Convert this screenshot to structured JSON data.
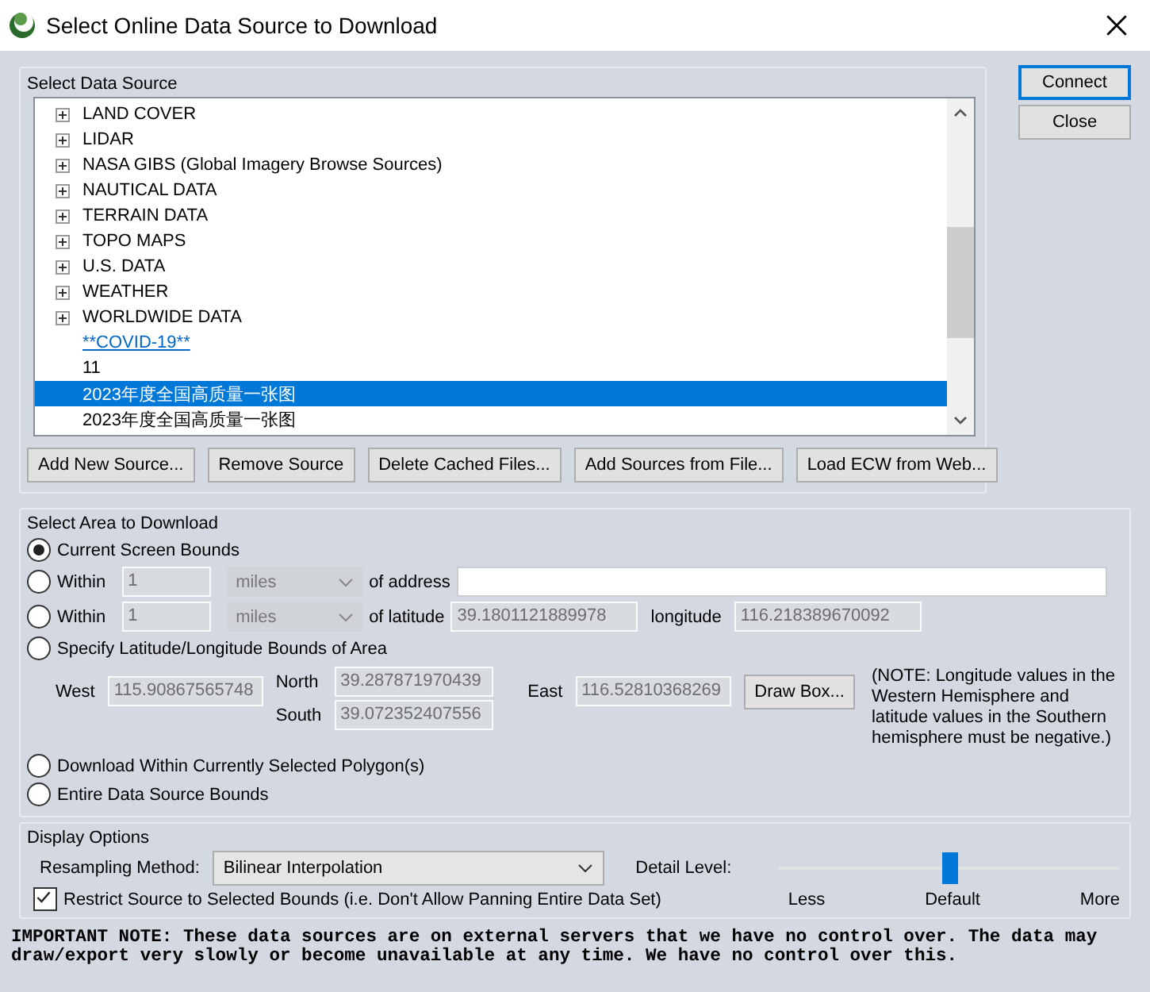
{
  "window": {
    "title": "Select Online Data Source to Download"
  },
  "side_buttons": [
    {
      "label": "Connect",
      "default": true
    },
    {
      "label": "Close",
      "default": false
    }
  ],
  "source_group": {
    "title": "Select Data Source",
    "items": [
      {
        "label": "LAND COVER",
        "kind": "folder",
        "selected": false
      },
      {
        "label": "LIDAR",
        "kind": "folder",
        "selected": false
      },
      {
        "label": "NASA GIBS (Global Imagery Browse Sources)",
        "kind": "folder",
        "selected": false
      },
      {
        "label": "NAUTICAL DATA",
        "kind": "folder",
        "selected": false
      },
      {
        "label": "TERRAIN DATA",
        "kind": "folder",
        "selected": false
      },
      {
        "label": "TOPO MAPS",
        "kind": "folder",
        "selected": false
      },
      {
        "label": "U.S. DATA",
        "kind": "folder",
        "selected": false
      },
      {
        "label": "WEATHER",
        "kind": "folder",
        "selected": false
      },
      {
        "label": "WORLDWIDE DATA",
        "kind": "folder",
        "selected": false
      },
      {
        "label": "**COVID-19**",
        "kind": "link",
        "selected": false
      },
      {
        "label": "11",
        "kind": "source",
        "selected": false
      },
      {
        "label": "2023年度全国高质量一张图",
        "kind": "source",
        "selected": true
      },
      {
        "label": "2023年度全国高质量一张图",
        "kind": "source",
        "selected": false
      }
    ],
    "buttons": [
      "Add New Source...",
      "Remove Source",
      "Delete Cached Files...",
      "Add Sources from File...",
      "Load ECW from Web..."
    ]
  },
  "area_group": {
    "title": "Select Area to Download",
    "options": [
      {
        "kind": "plain",
        "label": "Current Screen Bounds",
        "selected": true
      },
      {
        "kind": "address",
        "label": "Within",
        "radius": "1",
        "unit": "miles",
        "of_label": "of address",
        "disabled": true,
        "selected": false
      },
      {
        "kind": "point",
        "label": "Within",
        "radius": "1",
        "unit": "miles",
        "of_label": "of latitude",
        "latitude": "39.1801121889978",
        "lon_label": "longitude",
        "longitude": "116.218389670092",
        "disabled": true,
        "selected": false
      },
      {
        "kind": "bounds",
        "label": "Specify Latitude/Longitude Bounds of Area",
        "selected": false,
        "disabled": true,
        "west_label": "West",
        "west": "115.90867565748",
        "north_label": "North",
        "north": "39.287871970439",
        "south_label": "South",
        "south": "39.072352407556",
        "east_label": "East",
        "east": "116.52810368269",
        "draw_button": "Draw Box...",
        "note": "(NOTE: Longitude values in the Western Hemisphere and latitude values in the Southern hemisphere must be negative.)"
      },
      {
        "kind": "plain",
        "label": "Download Within Currently Selected Polygon(s)",
        "selected": false
      },
      {
        "kind": "plain",
        "label": "Entire Data Source Bounds",
        "selected": false
      }
    ]
  },
  "display_group": {
    "title": "Display Options",
    "resampling_label": "Resampling Method:",
    "resampling": "Bilinear Interpolation",
    "detail_label": "Detail Level:",
    "detail": {
      "level": 0.5,
      "ticks": [
        "Less",
        "Default",
        "More"
      ]
    },
    "restrict": {
      "label": "Restrict Source to Selected Bounds (i.e. Don't Allow Panning Entire Data Set)",
      "checked": true
    }
  },
  "note": "IMPORTANT NOTE: These data sources are on external servers that we have no control over. The data may draw/export very slowly or become unavailable at any time. We have no control over this."
}
